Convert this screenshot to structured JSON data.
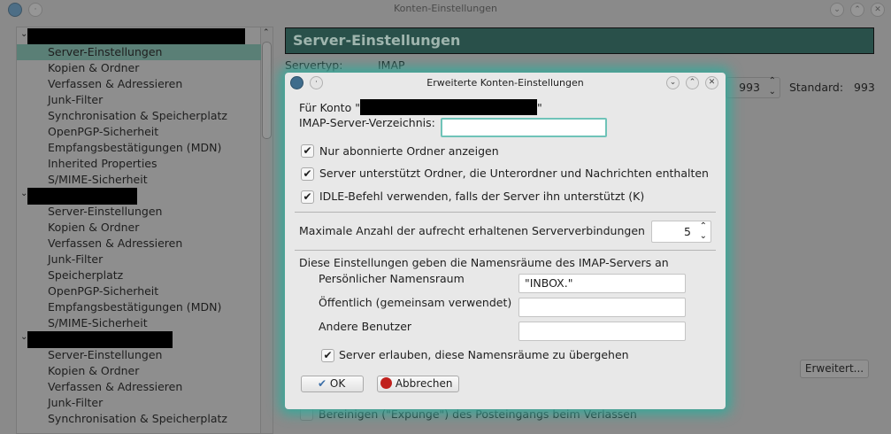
{
  "window": {
    "title": "Konten-Einstellungen"
  },
  "tree": {
    "accounts": [
      {
        "items": [
          "Server-Einstellungen",
          "Kopien & Ordner",
          "Verfassen & Adressieren",
          "Junk-Filter",
          "Synchronisation & Speicherplatz",
          "OpenPGP-Sicherheit",
          "Empfangsbestätigungen (MDN)",
          "Inherited Properties",
          "S/MIME-Sicherheit"
        ]
      },
      {
        "items": [
          "Server-Einstellungen",
          "Kopien & Ordner",
          "Verfassen & Adressieren",
          "Junk-Filter",
          "Speicherplatz",
          "OpenPGP-Sicherheit",
          "Empfangsbestätigungen (MDN)",
          "S/MIME-Sicherheit"
        ]
      },
      {
        "items": [
          "Server-Einstellungen",
          "Kopien & Ordner",
          "Verfassen & Adressieren",
          "Junk-Filter",
          "Synchronisation & Speicherplatz"
        ]
      }
    ]
  },
  "main": {
    "header": "Server-Einstellungen",
    "servertype_label": "Servertyp:",
    "servertype_value": "IMAP",
    "port_value": "993",
    "standard_label": "Standard:",
    "standard_value": "993",
    "advanced_button": "Erweitert...",
    "expunge_label": "Bereinigen (\"Expunge\") des Posteingangs beim Verlassen"
  },
  "dialog": {
    "title": "Erweiterte Konten-Einstellungen",
    "account_prefix": "Für Konto \"",
    "account_suffix": "\"",
    "imap_dir_label": "IMAP-Server-Verzeichnis:",
    "imap_dir_value": "",
    "cb_subscribed": "Nur abonnierte Ordner anzeigen",
    "cb_dual": "Server unterstützt Ordner, die Unterordner und Nachrichten enthalten",
    "cb_idle": "IDLE-Befehl verwenden, falls der Server ihn unterstützt (K)",
    "max_conn_label": "Maximale Anzahl der aufrecht erhaltenen Serververbindungen",
    "max_conn_value": "5",
    "ns_intro": "Diese Einstellungen geben die Namensräume des IMAP-Servers an",
    "ns_personal_label": "Persönlicher Namensraum",
    "ns_personal_value": "\"INBOX.\"",
    "ns_public_label": "Öffentlich (gemeinsam verwendet)",
    "ns_public_value": "",
    "ns_other_label": "Andere Benutzer",
    "ns_other_value": "",
    "cb_override": "Server erlauben, diese Namensräume zu übergehen",
    "ok": "OK",
    "cancel": "Abbrechen"
  }
}
